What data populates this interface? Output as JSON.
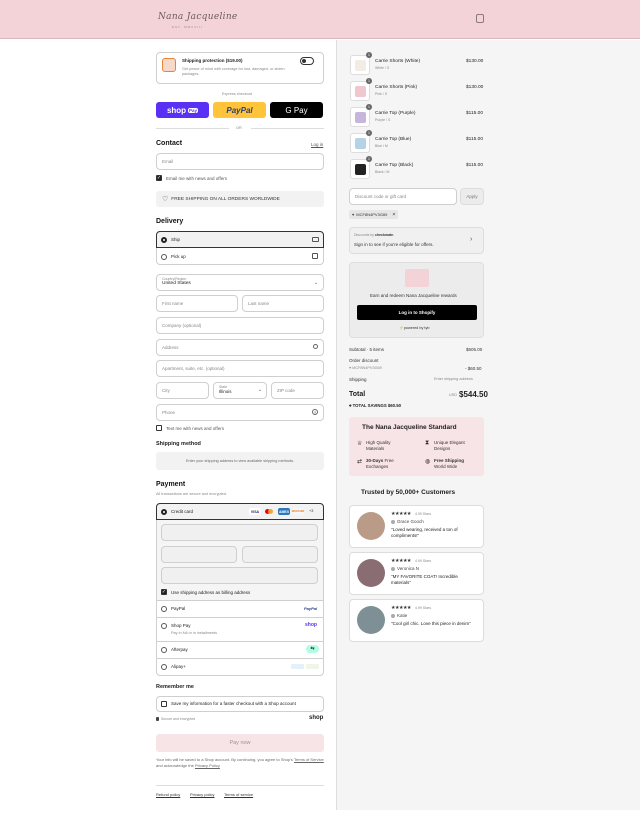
{
  "brand": {
    "logo": "Nana Jacqueline",
    "tagline": "EST. MMXVIII"
  },
  "shipping_protection": {
    "title": "Shipping protection ($19.00)",
    "desc": "Get peace of mind with coverage for lost, damaged, or stolen packages."
  },
  "express": {
    "label": "Express checkout",
    "shop": "shop",
    "shop_pay": "Pay",
    "paypal": "PayPal",
    "gpay": "G Pay",
    "or": "OR"
  },
  "contact": {
    "title": "Contact",
    "login": "Log in",
    "email_placeholder": "Email",
    "email_news": "Email me with news and offers"
  },
  "banner": {
    "text": "FREE SHIPPING ON ALL ORDERS WORLDWIDE"
  },
  "delivery": {
    "title": "Delivery",
    "ship": "Ship",
    "pickup": "Pick up",
    "country_label": "Country/Region",
    "country_value": "United States",
    "first_name": "First name",
    "last_name": "Last name",
    "company": "Company (optional)",
    "address": "Address",
    "apartment": "Apartment, suite, etc. (optional)",
    "city": "City",
    "state_label": "State",
    "state_value": "Illinois",
    "zip": "ZIP code",
    "phone": "Phone",
    "text_news": "Text me with news and offers"
  },
  "shipping_method": {
    "title": "Shipping method",
    "placeholder": "Enter your shipping address to view available shipping methods."
  },
  "payment": {
    "title": "Payment",
    "subtitle": "All transactions are secure and encrypted.",
    "credit_card": "Credit card",
    "card_more": "+3",
    "use_shipping": "Use shipping address as billing address",
    "paypal": "PayPal",
    "shoppay": "Shop Pay",
    "shoppay_sub": "Pay in full or in installments",
    "afterpay": "Afterpay",
    "alipay": "Alipay+",
    "visa": "VISA",
    "amex": "AMEX",
    "discover": "DISCOVER"
  },
  "remember": {
    "title": "Remember me",
    "save": "Save my information for a faster checkout with a Shop account",
    "secure": "Secure and encrypted",
    "shop": "shop"
  },
  "pay_now": "Pay now",
  "legal": {
    "text": "Your info will be saved to a Shop account. By continuing, you agree to Shop's",
    "terms": "Terms of Service",
    "and": "and acknowledge the",
    "privacy": "Privacy Policy"
  },
  "footer": {
    "refund": "Refund policy",
    "privacy": "Privacy policy",
    "terms": "Terms of service"
  },
  "cart": {
    "items": [
      {
        "name": "Carrie Shorts (White)",
        "variant": "White / S",
        "price": "$130.00",
        "qty": "1",
        "color": "#f1ece4"
      },
      {
        "name": "Carrie Shorts (Pink)",
        "variant": "Pink / S",
        "price": "$130.00",
        "qty": "1",
        "color": "#f0c6cf"
      },
      {
        "name": "Carrie Top (Purple)",
        "variant": "Purple / S",
        "price": "$115.00",
        "qty": "1",
        "color": "#c7b6dc"
      },
      {
        "name": "Carrie Top (Blue)",
        "variant": "Blue / M",
        "price": "$115.00",
        "qty": "1",
        "color": "#b5d2e6"
      },
      {
        "name": "Carrie Top (Black)",
        "variant": "Black / M",
        "price": "$115.00",
        "qty": "1",
        "color": "#222"
      }
    ],
    "discount_placeholder": "Discount code or gift card",
    "apply": "Apply",
    "code": "MCF8N4PV3G69"
  },
  "checkmate": {
    "label": "Discounts by",
    "brand": "checkmate.",
    "text": "Sign in to see if you're eligible for offers."
  },
  "rewards": {
    "text": "Earn and redeem Nana Jacqueline rewards",
    "button": "Log in to Shopify",
    "powered": "powered by tyb"
  },
  "summary": {
    "subtotal_label": "Subtotal · 5 items",
    "subtotal": "$605.00",
    "discount_label": "Order discount",
    "discount_code": "MCF8N4PV3G69",
    "discount": "- $60.50",
    "shipping_label": "Shipping",
    "shipping": "Enter shipping address",
    "total_label": "Total",
    "currency": "USD",
    "total": "$544.50",
    "savings_label": "TOTAL SAVINGS",
    "savings": "$60.50"
  },
  "standard": {
    "title": "The Nana Jacqueline Standard",
    "f1a": "High Quality",
    "f1b": "Materials",
    "f2a": "Unique Elegant",
    "f2b": "Designs",
    "f3a": "30-Days",
    "f3a2": " Free",
    "f3b": "Exchanges",
    "f4a": "Free Shipping",
    "f4b": "World Wide"
  },
  "trusted": "Trusted by 50,000+ Customers",
  "reviews": [
    {
      "stars": "★★★★★",
      "score": "4.99 Stars",
      "name": "Grace Gooch",
      "quote": "\"Loved wearing, received a ton of compliments!\""
    },
    {
      "stars": "★★★★★",
      "score": "4.99 Stars",
      "name": "Veronica N",
      "quote": "\"MY FAVORITE COAT! Incredible materials\""
    },
    {
      "stars": "★★★★★",
      "score": "4.99 Stars",
      "name": "Katie",
      "quote": "\"Cool girl chic. Love this piece in denim\""
    }
  ]
}
